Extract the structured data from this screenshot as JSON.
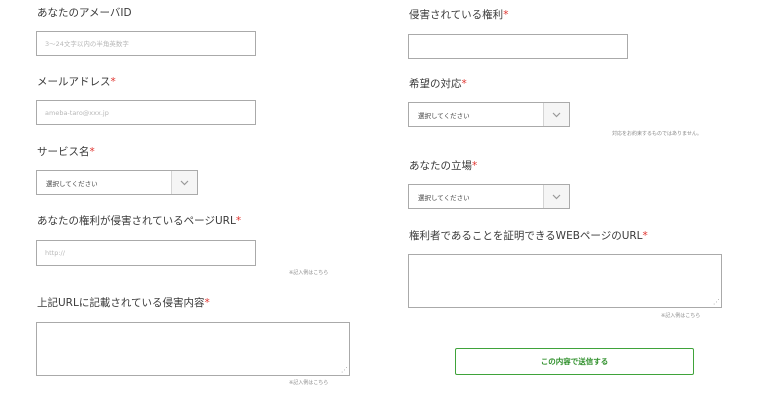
{
  "left": {
    "ameba_id": {
      "label": "あなたのアメーバID",
      "placeholder": "3～24文字以内の半角英数字"
    },
    "email": {
      "label": "メールアドレス",
      "required": "*",
      "placeholder": "ameba-taro@xxx.jp"
    },
    "service": {
      "label": "サービス名",
      "required": "*",
      "selected": "選択してください"
    },
    "page_url": {
      "label": "あなたの権利が侵害されているページURL",
      "required": "*",
      "placeholder": "http://",
      "note": "※記入例はこちら"
    },
    "content": {
      "label": "上記URLに記載されている侵害内容",
      "required": "*",
      "note": "※記入例はこちら"
    }
  },
  "right": {
    "infringed_right": {
      "label": "侵害されている権利",
      "required": "*"
    },
    "desired_action": {
      "label": "希望の対応",
      "required": "*",
      "selected": "選択してください",
      "note": "対応をお約束するものではありません。"
    },
    "position": {
      "label": "あなたの立場",
      "required": "*",
      "selected": "選択してください"
    },
    "proof_url": {
      "label": "権利者であることを証明できるWEBページのURL",
      "required": "*",
      "note": "※記入例はこちら"
    },
    "submit_label": "この内容で送信する"
  },
  "icons": {
    "select_arrow": "chevron-down-icon",
    "resize": "resize-grip-icon"
  },
  "colors": {
    "required": "#e0342f",
    "accent": "#3fa33a",
    "border": "#aaaaaa"
  }
}
